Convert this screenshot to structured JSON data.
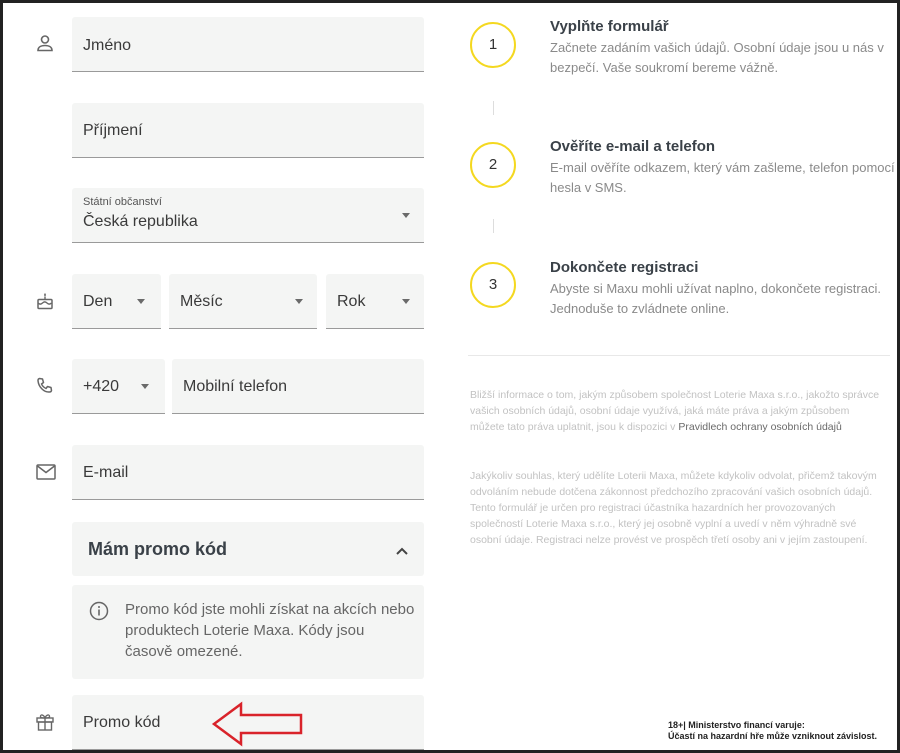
{
  "form": {
    "first_name_placeholder": "Jméno",
    "last_name_placeholder": "Příjmení",
    "citizenship": {
      "label": "Státní občanství",
      "value": "Česká republika"
    },
    "dob": {
      "day": "Den",
      "month": "Měsíc",
      "year": "Rok"
    },
    "phone": {
      "prefix": "+420",
      "placeholder": "Mobilní telefon"
    },
    "email_placeholder": "E-mail",
    "promo": {
      "toggle_label": "Mám promo kód",
      "info_text": "Promo kód jste mohli získat na akcích nebo produktech Loterie Maxa. Kódy jsou časově omezené.",
      "input_placeholder": "Promo kód"
    }
  },
  "steps": [
    {
      "number": "1",
      "title": "Vyplňte formulář",
      "description": "Začnete zadáním vašich údajů. Osobní údaje jsou u nás v bezpečí. Vaše soukromí bereme vážně."
    },
    {
      "number": "2",
      "title": "Ověříte e-mail a telefon",
      "description": "E-mail ověříte odkazem, který vám zašleme, telefon pomocí hesla v SMS."
    },
    {
      "number": "3",
      "title": "Dokončete registraci",
      "description": "Abyste si Maxu mohli užívat naplno, dokončete registraci. Jednoduše to zvládnete online."
    }
  ],
  "privacy": {
    "text": "Bližší informace o tom, jakým způsobem společnost Loterie Maxa s.r.o., jakožto správce vašich osobních údajů, osobní údaje využívá, jaká máte práva a jakým způsobem můžete tato práva uplatnit, jsou k dispozici v ",
    "link": "Pravidlech ochrany osobních údajů",
    "consent": "Jakýkoliv souhlas, který udělíte Loterii Maxa, můžete kdykoliv odvolat, přičemž takovým odvoláním nebude dotčena zákonnost předchozího zpracování vašich osobních údajů. Tento formulář je určen pro registraci účastníka hazardních her provozovaných společností Loterie Maxa s.r.o., který jej osobně vyplní a uvedí v něm výhradně své osobní údaje. Registraci nelze provést ve prospěch třetí osoby ani v jejím zastoupení."
  },
  "legal": {
    "line1": "18+| Ministerstvo financí varuje:",
    "line2": "Účastí na hazardní hře může vzniknout závislost."
  },
  "colors": {
    "step_ring": "#f4d820",
    "annotation_arrow": "#d9232a",
    "field_bg": "#f4f5f4"
  },
  "icons": [
    "person-icon",
    "cake-icon",
    "phone-icon",
    "mail-icon",
    "gift-icon",
    "info-icon",
    "chevron-up-icon",
    "arrow-annotation"
  ]
}
